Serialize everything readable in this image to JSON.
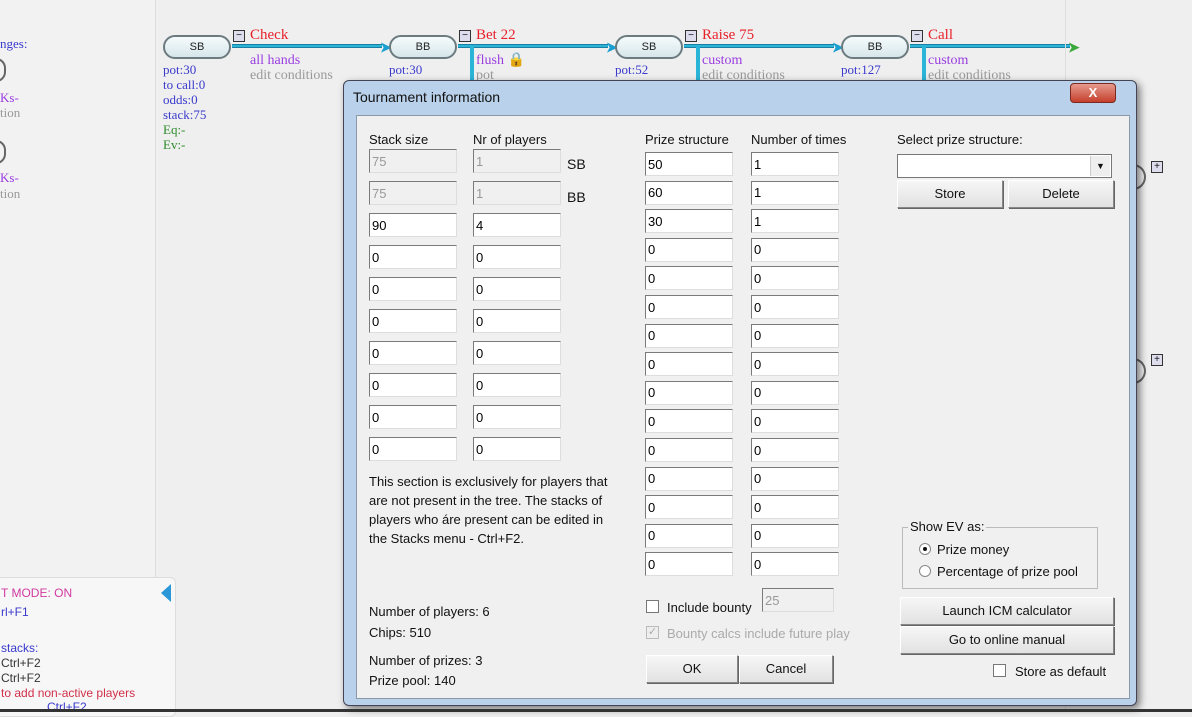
{
  "left_pane": {
    "text_top": "nges:",
    "item1_a": "Ks-",
    "item1_b": "tion",
    "item2_a": "Ks-",
    "item2_b": "tion",
    "help": {
      "mode": "T MODE: ON",
      "l1": "rl+F1",
      "l2": "stacks:",
      "l3": "Ctrl+F2",
      "l4": "Ctrl+F2",
      "l5": "to add non-active players",
      "l6": "...Ctrl+F2"
    }
  },
  "tree": {
    "nodes": [
      {
        "label": "SB",
        "pot": "pot:30"
      },
      {
        "label": "BB",
        "pot": "pot:30"
      },
      {
        "label": "SB",
        "pot": "pot:52"
      },
      {
        "label": "BB",
        "pot": "pot:127"
      }
    ],
    "first_info": {
      "to_call": "to call:0",
      "odds": "odds:0",
      "stack": "stack:75",
      "eq": "Eq:-",
      "ev": "Ev:-"
    },
    "actions": [
      {
        "label": "Check",
        "range": "all hands",
        "cond": "edit conditions"
      },
      {
        "label": "Bet 22",
        "range": "flush",
        "cond": "pot"
      },
      {
        "label": "Raise 75",
        "range": "custom",
        "cond": "edit conditions"
      },
      {
        "label": "Call",
        "range": "custom",
        "cond": "edit conditions"
      }
    ]
  },
  "dialog": {
    "title": "Tournament information",
    "close": "X",
    "stack_header": "Stack size",
    "players_header": "Nr of players",
    "sb_label": "SB",
    "bb_label": "BB",
    "stack_rows": [
      [
        "75",
        "1"
      ],
      [
        "75",
        "1"
      ],
      [
        "90",
        "4"
      ],
      [
        "0",
        "0"
      ],
      [
        "0",
        "0"
      ],
      [
        "0",
        "0"
      ],
      [
        "0",
        "0"
      ],
      [
        "0",
        "0"
      ],
      [
        "0",
        "0"
      ],
      [
        "0",
        "0"
      ]
    ],
    "note": "This section is exclusively for players that are not present in the tree. The stacks of players who áre present can be edited in the Stacks menu - Ctrl+F2.",
    "num_players": "Number of players: 6",
    "chips": "Chips: 510",
    "num_prizes": "Number of prizes: 3",
    "prize_pool": "Prize pool: 140",
    "prize_header": "Prize structure",
    "times_header": "Number of times",
    "prize_rows": [
      [
        "50",
        "1"
      ],
      [
        "60",
        "1"
      ],
      [
        "30",
        "1"
      ],
      [
        "0",
        "0"
      ],
      [
        "0",
        "0"
      ],
      [
        "0",
        "0"
      ],
      [
        "0",
        "0"
      ],
      [
        "0",
        "0"
      ],
      [
        "0",
        "0"
      ],
      [
        "0",
        "0"
      ],
      [
        "0",
        "0"
      ],
      [
        "0",
        "0"
      ],
      [
        "0",
        "0"
      ],
      [
        "0",
        "0"
      ],
      [
        "0",
        "0"
      ]
    ],
    "include_bounty": "Include bounty",
    "bounty_value": "25",
    "bounty_future": "Bounty calcs include future play",
    "ok": "OK",
    "cancel": "Cancel",
    "select_label": "Select prize structure:",
    "select_value": "",
    "store": "Store",
    "delete": "Delete",
    "show_ev_label": "Show EV as:",
    "ev_options": [
      "Prize money",
      "Percentage of prize pool"
    ],
    "ev_selected": "Prize money",
    "launch_icm": "Launch ICM calculator",
    "manual": "Go to online manual",
    "store_default": "Store as default"
  }
}
